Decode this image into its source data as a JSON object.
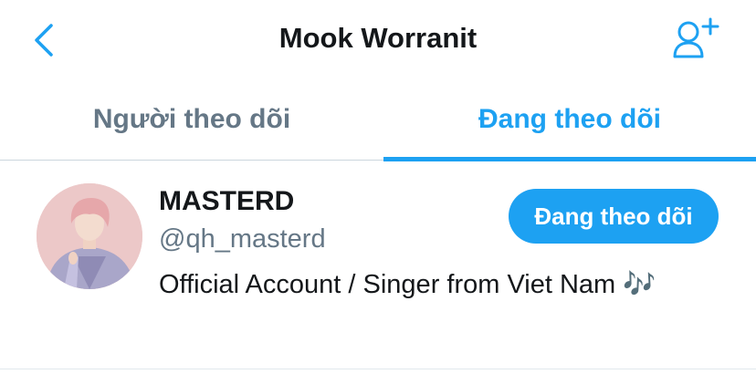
{
  "header": {
    "title": "Mook Worranit",
    "back_icon": "chevron-left-icon",
    "add_user_icon": "add-user-icon"
  },
  "tabs": [
    {
      "label": "Người theo dõi",
      "active": false
    },
    {
      "label": "Đang theo dõi",
      "active": true
    }
  ],
  "user": {
    "name": "MASTERD",
    "handle": "@qh_masterd",
    "bio": "Official Account / Singer from Viet Nam 🎶",
    "follow_label": "Đang theo dõi"
  },
  "colors": {
    "accent": "#1da1f2",
    "text_primary": "#14171a",
    "text_secondary": "#657786",
    "divider": "#ccd6dd"
  }
}
